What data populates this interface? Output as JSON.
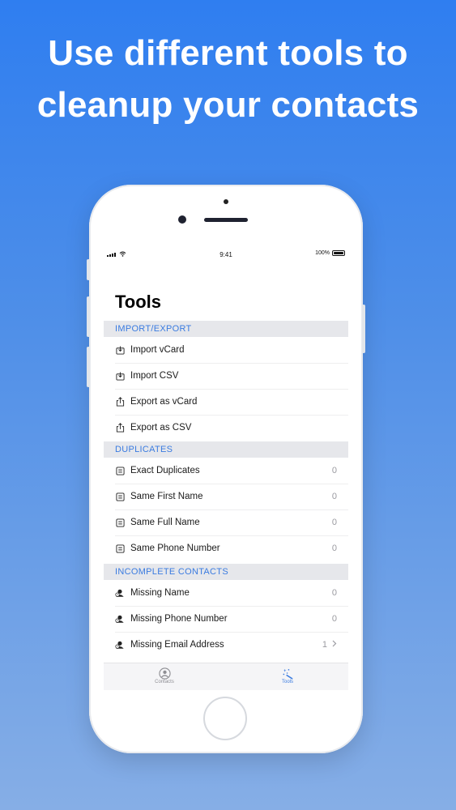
{
  "headline": {
    "line1": "Use different tools to",
    "line2": "cleanup your contacts"
  },
  "status_bar": {
    "time": "9:41",
    "battery": "100%"
  },
  "page_title": "Tools",
  "sections": {
    "import_export": {
      "title": "IMPORT/EXPORT",
      "items": [
        {
          "label": "Import vCard",
          "icon": "import-icon"
        },
        {
          "label": "Import CSV",
          "icon": "import-icon"
        },
        {
          "label": "Export as vCard",
          "icon": "share-icon"
        },
        {
          "label": "Export as CSV",
          "icon": "share-icon"
        }
      ]
    },
    "duplicates": {
      "title": "DUPLICATES",
      "items": [
        {
          "label": "Exact Duplicates",
          "count": "0",
          "icon": "list-icon"
        },
        {
          "label": "Same First Name",
          "count": "0",
          "icon": "list-icon"
        },
        {
          "label": "Same Full Name",
          "count": "0",
          "icon": "list-icon"
        },
        {
          "label": "Same Phone Number",
          "count": "0",
          "icon": "list-icon"
        }
      ]
    },
    "incomplete": {
      "title": "INCOMPLETE CONTACTS",
      "items": [
        {
          "label": "Missing Name",
          "count": "0",
          "icon": "person-question-icon"
        },
        {
          "label": "Missing Phone Number",
          "count": "0",
          "icon": "person-question-icon"
        },
        {
          "label": "Missing Email Address",
          "count": "1",
          "icon": "person-question-icon"
        }
      ]
    }
  },
  "tabbar": {
    "contacts": "Contacts",
    "tools": "Tools"
  },
  "colors": {
    "accent": "#3a7be0",
    "background_top": "#2f7ef0",
    "background_bottom": "#86aee6"
  }
}
